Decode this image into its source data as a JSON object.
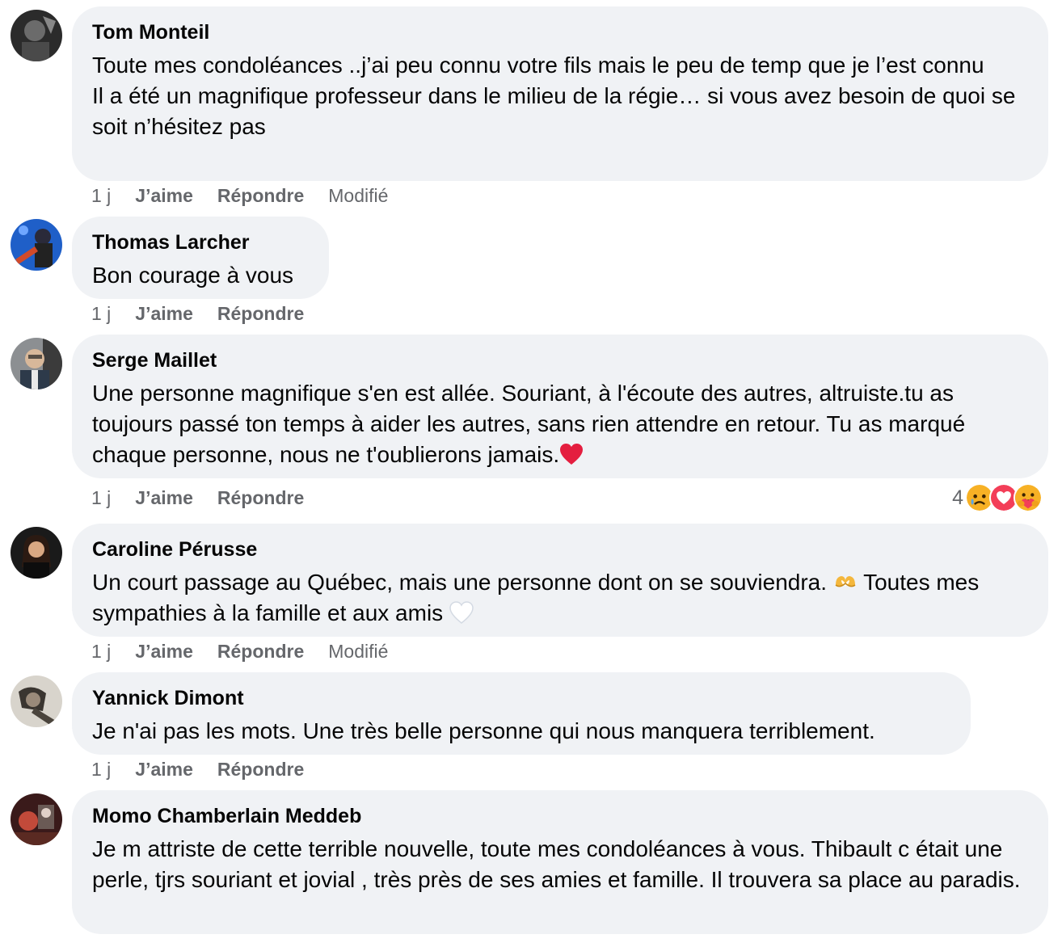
{
  "comments": [
    {
      "author": "Tom Monteil",
      "text": "Toute mes condoléances ..j’ai peu connu votre fils mais le peu de temp que je l’est connu\nIl a été un magnifique professeur dans le milieu de la régie… si vous avez besoin de quoi se soit n’hésitez pas",
      "time": "1 j",
      "like": "J’aime",
      "reply": "Répondre",
      "edited": "Modifié"
    },
    {
      "author": "Thomas Larcher",
      "text": "Bon courage à vous",
      "time": "1 j",
      "like": "J’aime",
      "reply": "Répondre"
    },
    {
      "author": "Serge Maillet",
      "text": "Une personne magnifique s'en est allée. Souriant, à l'écoute des autres, altruiste.tu as toujours passé ton temps à aider les autres, sans rien attendre en retour. Tu as marqué chaque personne, nous ne t'oublierons jamais.",
      "trailing_emoji": "red-heart-icon",
      "time": "1 j",
      "like": "J’aime",
      "reply": "Répondre",
      "reaction_count": "4",
      "reactions": [
        "sad-reaction-icon",
        "love-reaction-icon",
        "care-reaction-icon"
      ]
    },
    {
      "author": "Caroline Pérusse",
      "text_part1": "Un court passage au Québec, mais une personne dont on se souviendra. ",
      "text_emoji1": "heart-hands-icon",
      "text_part2": " Toutes mes sympathies à la famille et aux amis ",
      "text_emoji2": "white-heart-icon",
      "time": "1 j",
      "like": "J’aime",
      "reply": "Répondre",
      "edited": "Modifié"
    },
    {
      "author": "Yannick Dimont",
      "text": "Je n'ai pas les mots. Une très belle personne qui nous manquera terriblement.",
      "time": "1 j",
      "like": "J’aime",
      "reply": "Répondre"
    },
    {
      "author": "Momo Chamberlain Meddeb",
      "text": "Je m attriste de cette terrible nouvelle, toute mes condoléances à vous. Thibault c était une perle, tjrs souriant et jovial , très près de ses amies et famille. Il trouvera sa place au paradis."
    }
  ],
  "colors": {
    "bubble": "#f0f2f5",
    "meta_text": "#65676b",
    "text": "#050505",
    "heart": "#e41e3f"
  }
}
